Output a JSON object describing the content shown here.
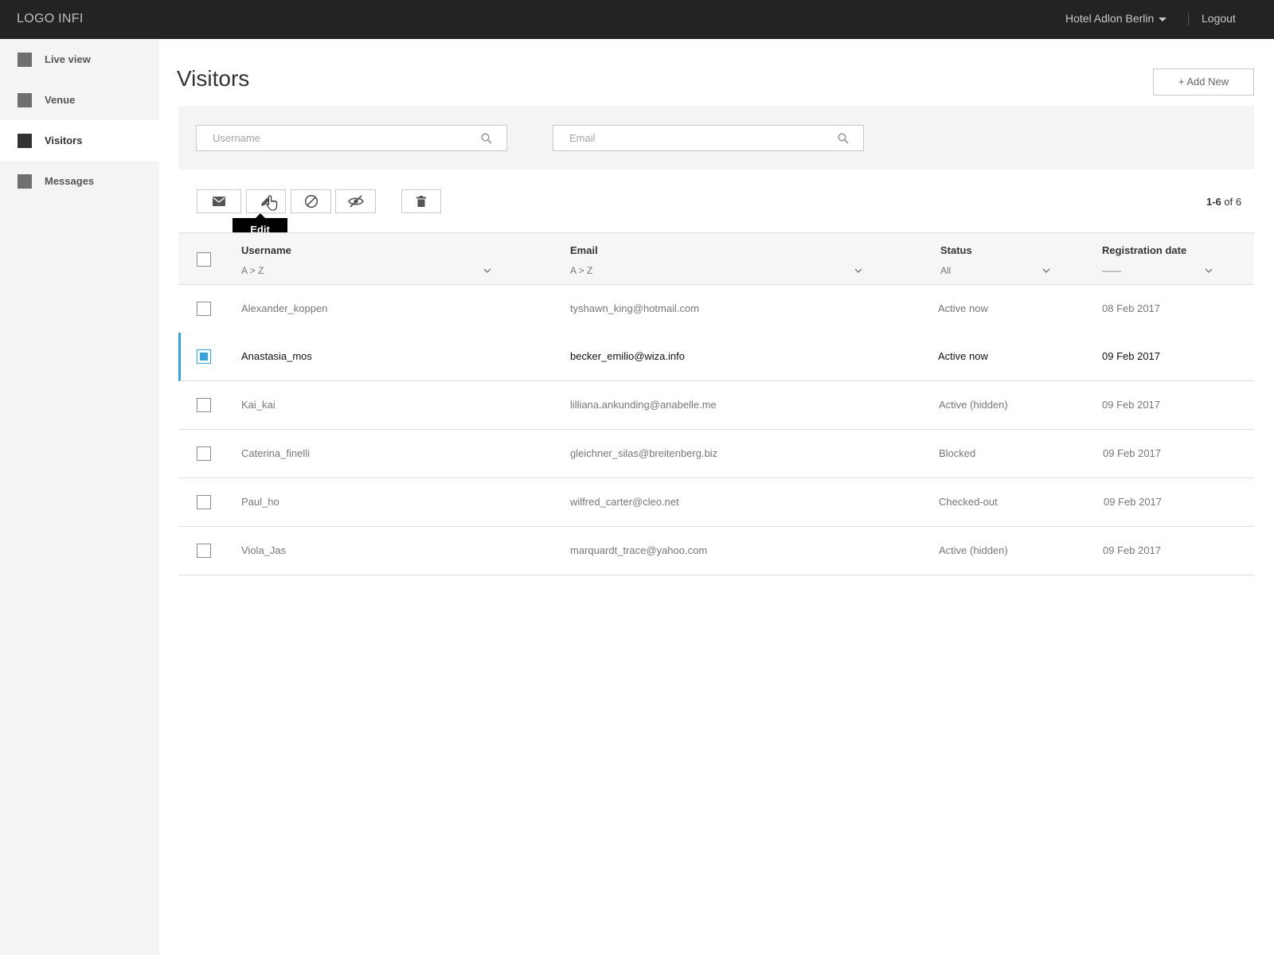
{
  "header": {
    "logo": "LOGO INFI",
    "venue": "Hotel Adlon Berlin",
    "logout": "Logout"
  },
  "sidebar": {
    "items": [
      {
        "label": "Live view",
        "icon": "square-icon"
      },
      {
        "label": "Venue",
        "icon": "square-icon"
      },
      {
        "label": "Visitors",
        "icon": "square-icon",
        "active": true
      },
      {
        "label": "Messages",
        "icon": "square-icon"
      }
    ]
  },
  "main": {
    "title": "Visitors",
    "add_new": "+ Add New"
  },
  "filters": {
    "username_placeholder": "Username",
    "email_placeholder": "Email"
  },
  "toolbar": {
    "buttons": [
      "envelope-icon",
      "pencil-icon",
      "block-icon",
      "eye-slash-icon",
      "trash-icon"
    ],
    "tooltip": "Edit",
    "pager_range": "1-6",
    "pager_rest": "of 6"
  },
  "table": {
    "columns": [
      {
        "label": "Username",
        "sort": "A > Z"
      },
      {
        "label": "Email",
        "sort": "A > Z"
      },
      {
        "label": "Status",
        "sort": "All"
      },
      {
        "label": "Registration date",
        "sort": "——"
      }
    ],
    "rows": [
      {
        "username": "Alexander_koppen",
        "email": "tyshawn_king@hotmail.com",
        "status": "Active now",
        "date": "08 Feb 2017",
        "selected": false
      },
      {
        "username": "Anastasia_mos",
        "email": "becker_emilio@wiza.info",
        "status": "Active now",
        "date": "09 Feb 2017",
        "selected": true
      },
      {
        "username": "Kai_kai",
        "email": "lilliana.ankunding@anabelle.me",
        "status": "Active (hidden)",
        "date": "09 Feb 2017",
        "selected": false
      },
      {
        "username": "Caterina_finelli",
        "email": "gleichner_silas@breitenberg.biz",
        "status": "Blocked",
        "date": "09 Feb 2017",
        "selected": false
      },
      {
        "username": "Paul_ho",
        "email": "wilfred_carter@cleo.net",
        "status": "Checked-out",
        "date": "09 Feb 2017",
        "selected": false
      },
      {
        "username": "Viola_Jas",
        "email": "marquardt_trace@yahoo.com",
        "status": "Active (hidden)",
        "date": "09 Feb 2017",
        "selected": false
      }
    ]
  },
  "colors": {
    "accent": "#35a3dc",
    "topbar": "#232323",
    "sidebar": "#f4f4f4"
  }
}
